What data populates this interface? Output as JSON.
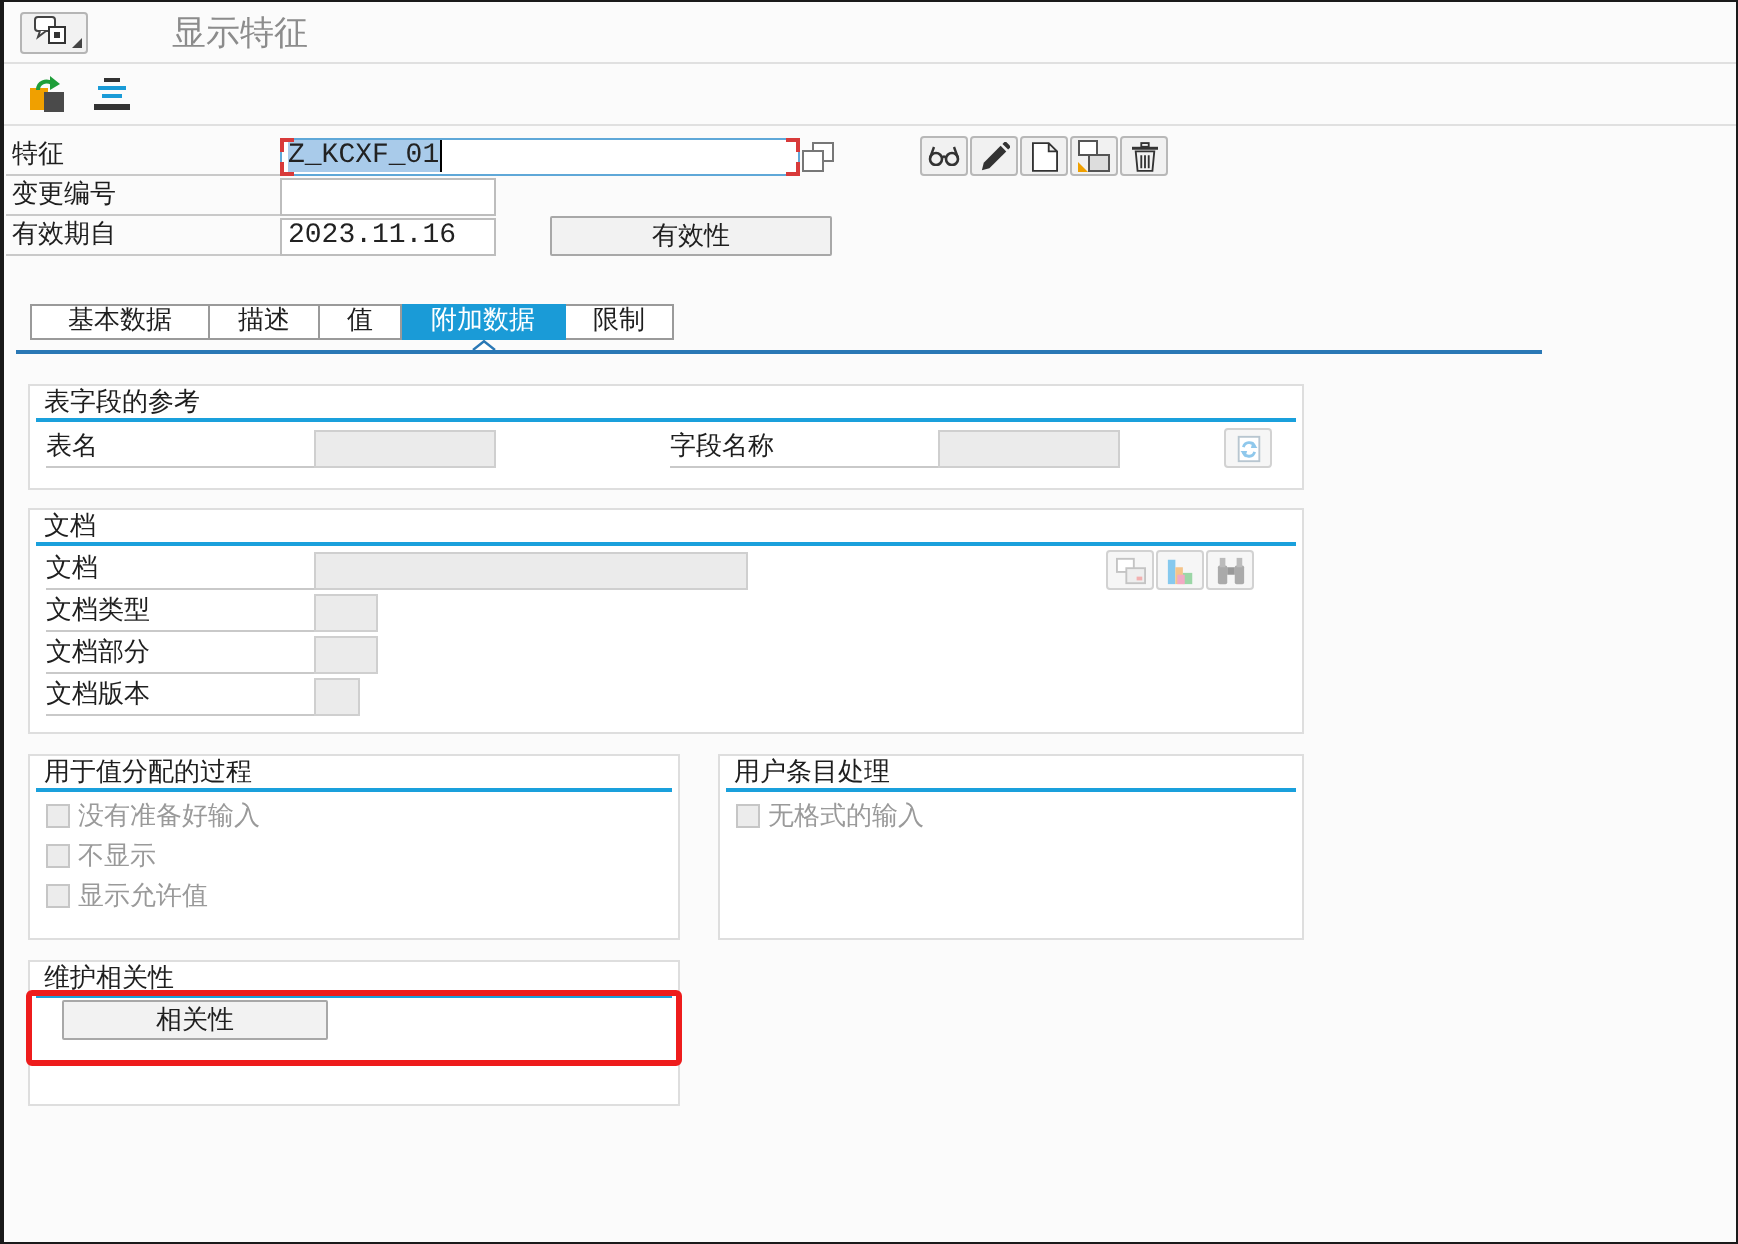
{
  "window": {
    "title": "显示特征"
  },
  "header": {
    "fields": [
      {
        "label": "特征",
        "value": "Z_KCXF_01",
        "focused": true,
        "disabled": false
      },
      {
        "label": "变更编号",
        "focused": false,
        "disabled": false
      },
      {
        "label": "有效期自",
        "value": "2023.11.16",
        "focused": false,
        "disabled": false
      }
    ],
    "validity_button": "有效性"
  },
  "tabs": [
    {
      "label": "基本数据",
      "selected": false
    },
    {
      "label": "描述",
      "selected": false
    },
    {
      "label": "值",
      "selected": false
    },
    {
      "label": "附加数据",
      "selected": true
    },
    {
      "label": "限制",
      "selected": false
    }
  ],
  "table_field_reference": {
    "title": "表字段的参考",
    "fields": [
      {
        "label": "表名",
        "disabled": true
      },
      {
        "label": "字段名称",
        "disabled": true
      }
    ]
  },
  "document": {
    "title": "文档",
    "fields": [
      {
        "label": "文档",
        "disabled": true
      },
      {
        "label": "文档类型",
        "disabled": true
      },
      {
        "label": "文档部分",
        "disabled": true
      },
      {
        "label": "文档版本",
        "disabled": true
      }
    ]
  },
  "value_assignment": {
    "title": "用于值分配的过程",
    "options": [
      {
        "label": "没有准备好输入",
        "checked": false,
        "disabled": true
      },
      {
        "label": "不显示",
        "checked": false,
        "disabled": true
      },
      {
        "label": "显示允许值",
        "checked": false,
        "disabled": true
      }
    ]
  },
  "user_entry": {
    "title": "用户条目处理",
    "options": [
      {
        "label": "无格式的输入",
        "checked": false,
        "disabled": true
      }
    ]
  },
  "dependencies": {
    "title": "维护相关性",
    "button": "相关性",
    "highlighted": true
  }
}
